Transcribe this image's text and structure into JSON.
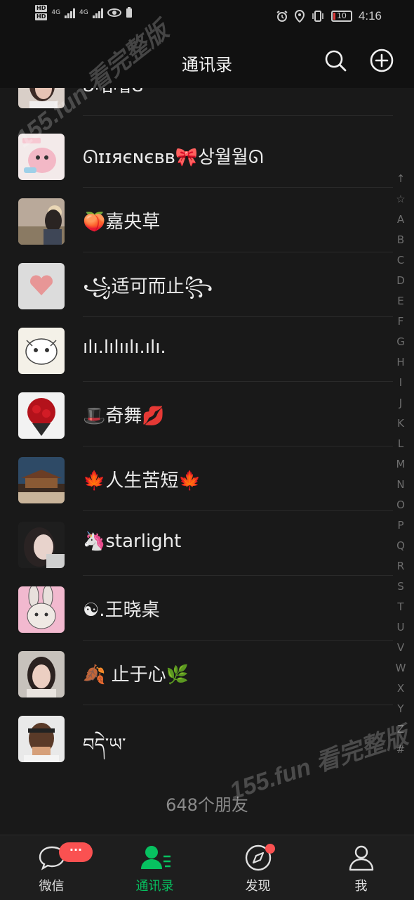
{
  "status_bar": {
    "hd1": "HD",
    "hd2": "HD",
    "net1": "4G",
    "net2": "4G",
    "battery": "10",
    "time": "4:16"
  },
  "header": {
    "title": "通讯录",
    "search_icon": "search-icon",
    "add_icon": "add-circle-icon"
  },
  "contacts": [
    {
      "name": "ʚ咕噜ɞ"
    },
    {
      "name": "ᘏɪɪяєɴєʙʙ🎀상월월ᘏ"
    },
    {
      "name": "🍑嘉央草"
    },
    {
      "name": "꧁适可而止꧂"
    },
    {
      "name": "ılı.lılıılı.ılı."
    },
    {
      "name": "🎩奇舞💋"
    },
    {
      "name": "🍁人生苦短🍁"
    },
    {
      "name": "🦄starlight"
    },
    {
      "name": "☯.王晓桌"
    },
    {
      "name": "🍂 止于心🌿"
    },
    {
      "name": "བདེ་ཡ་"
    }
  ],
  "friend_count": "648个朋友",
  "alphabet": [
    "↑",
    "☆",
    "A",
    "B",
    "C",
    "D",
    "E",
    "F",
    "G",
    "H",
    "I",
    "J",
    "K",
    "L",
    "M",
    "N",
    "O",
    "P",
    "Q",
    "R",
    "S",
    "T",
    "U",
    "V",
    "W",
    "X",
    "Y",
    "Z",
    "#"
  ],
  "watermark": {
    "top": "155.fun 看完整版",
    "bottom": "155.fun 看完整版"
  },
  "tabs": [
    {
      "label": "微信",
      "icon": "chat-bubble-icon",
      "badge": "···"
    },
    {
      "label": "通讯录",
      "icon": "contacts-icon"
    },
    {
      "label": "发现",
      "icon": "compass-icon"
    },
    {
      "label": "我",
      "icon": "person-icon"
    }
  ],
  "colors": {
    "accent": "#07c160",
    "badge": "#fa5151",
    "background": "#191919"
  }
}
